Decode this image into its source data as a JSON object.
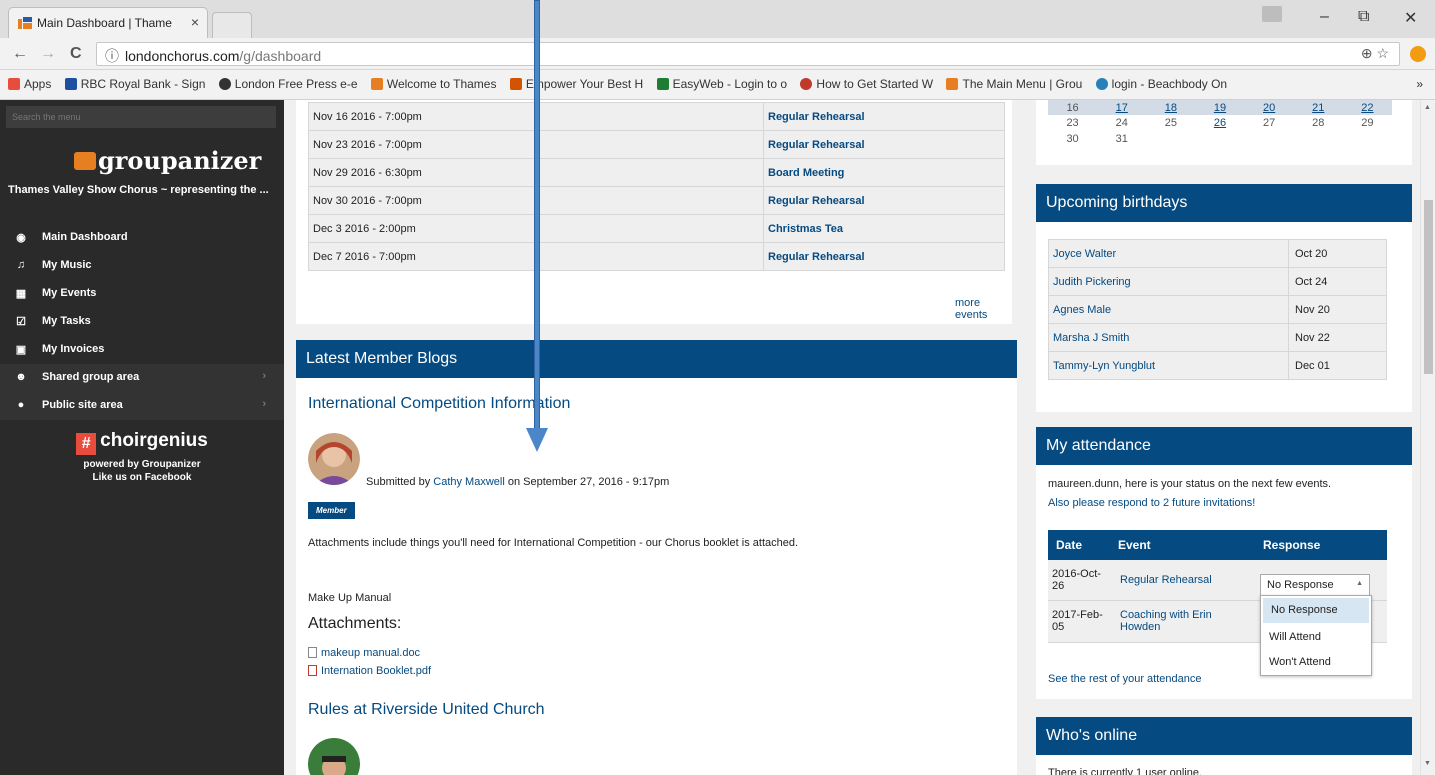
{
  "browser": {
    "tab_title": "Main Dashboard | Thame",
    "tab_close": "×",
    "url_domain": "londonchorus.com",
    "url_path": "/g/dashboard",
    "info_icon": "ⓘ",
    "back": "←",
    "forward": "→",
    "reload": "C",
    "zoom_icon": "⊕",
    "star_icon": "☆",
    "minimize": "–",
    "restore": "⧉",
    "close": "✕",
    "bookmarks": [
      {
        "label": "Apps",
        "color": "#e74c3c"
      },
      {
        "label": "RBC Royal Bank - Sign",
        "color": "#1f4fa0"
      },
      {
        "label": "London Free Press e-e",
        "color": "#333333"
      },
      {
        "label": "Welcome to Thames",
        "color": "#e67e22"
      },
      {
        "label": "Empower Your Best H",
        "color": "#d35400"
      },
      {
        "label": "EasyWeb - Login to o",
        "color": "#1e7d32"
      },
      {
        "label": "How to Get Started W",
        "color": "#c0392b"
      },
      {
        "label": "The Main Menu | Grou",
        "color": "#e67e22"
      },
      {
        "label": "login - Beachbody On",
        "color": "#2980b9"
      }
    ],
    "bookmarks_more": "»"
  },
  "sidebar": {
    "search_placeholder": "Search the menu",
    "brand": "groupanizer",
    "site_name": "Thames Valley Show Chorus ~ representing the ...",
    "items": [
      {
        "label": "Main Dashboard",
        "icon": "◉"
      },
      {
        "label": "My Music",
        "icon": "♫"
      },
      {
        "label": "My Events",
        "icon": "▦"
      },
      {
        "label": "My Tasks",
        "icon": "☑"
      },
      {
        "label": "My Invoices",
        "icon": "▣"
      },
      {
        "label": "Shared group area",
        "icon": "☻"
      },
      {
        "label": "Public site area",
        "icon": "●"
      }
    ],
    "chevron": "›",
    "cg_hash": "#",
    "cg_name": "choirgenius",
    "powered": "powered by Groupanizer",
    "facebook": "Like us on Facebook"
  },
  "events": {
    "rows": [
      {
        "date": "Nov 16 2016 - 7:00pm",
        "event": "Regular Rehearsal"
      },
      {
        "date": "Nov 23 2016 - 7:00pm",
        "event": "Regular Rehearsal"
      },
      {
        "date": "Nov 29 2016 - 6:30pm",
        "event": "Board Meeting"
      },
      {
        "date": "Nov 30 2016 - 7:00pm",
        "event": "Regular Rehearsal"
      },
      {
        "date": "Dec 3 2016 - 2:00pm",
        "event": "Christmas Tea"
      },
      {
        "date": "Dec 7 2016 - 7:00pm",
        "event": "Regular Rehearsal"
      }
    ],
    "more": "more events"
  },
  "blogs": {
    "title": "Latest Member Blogs",
    "post1_title": "International Competition Information",
    "submitted_prefix": "Submitted by",
    "author": "Cathy Maxwell",
    "submitted_on": "on September 27, 2016 - 9:17pm",
    "badge": "Member",
    "body": "Attachments include things you'll need for International Competition - our Chorus booklet is attached.",
    "makeup": "Make Up Manual",
    "attachments_heading": "Attachments:",
    "files": [
      "makeup manual.doc",
      "Internation Booklet.pdf"
    ],
    "post2_title": "Rules at Riverside United Church"
  },
  "calendar": {
    "row1": [
      "16",
      "17",
      "18",
      "19",
      "20",
      "21",
      "22"
    ],
    "row2": [
      "23",
      "24",
      "25",
      "26",
      "27",
      "28",
      "29"
    ],
    "row3": [
      "30",
      "31"
    ]
  },
  "birthdays": {
    "title": "Upcoming birthdays",
    "rows": [
      {
        "name": "Joyce Walter",
        "date": "Oct 20"
      },
      {
        "name": "Judith Pickering",
        "date": "Oct 24"
      },
      {
        "name": "Agnes Male",
        "date": "Nov 20"
      },
      {
        "name": "Marsha J Smith",
        "date": "Nov 22"
      },
      {
        "name": "Tammy-Lyn Yungblut",
        "date": "Dec 01"
      }
    ]
  },
  "attendance": {
    "title": "My attendance",
    "status_text": "maureen.dunn, here is your status on the next few events.",
    "respond_link": "Also please respond to 2 future invitations!",
    "headers": [
      "Date",
      "Event",
      "Response"
    ],
    "rows": [
      {
        "date": "2016-Oct-26",
        "event": "Regular Rehearsal",
        "response": "No Response"
      },
      {
        "date": "2017-Feb-05",
        "event": "Coaching with Erin Howden",
        "response": ""
      }
    ],
    "options": [
      "No Response",
      "Will Attend",
      "Won't Attend"
    ],
    "see_rest": "See the rest of your attendance"
  },
  "online": {
    "title": "Who's online",
    "text": "There is currently 1 user online."
  },
  "colors": {
    "header_blue": "#054a80",
    "sidebar_bg": "#2a2a2a",
    "annotation_arrow": "#4a86c8"
  }
}
